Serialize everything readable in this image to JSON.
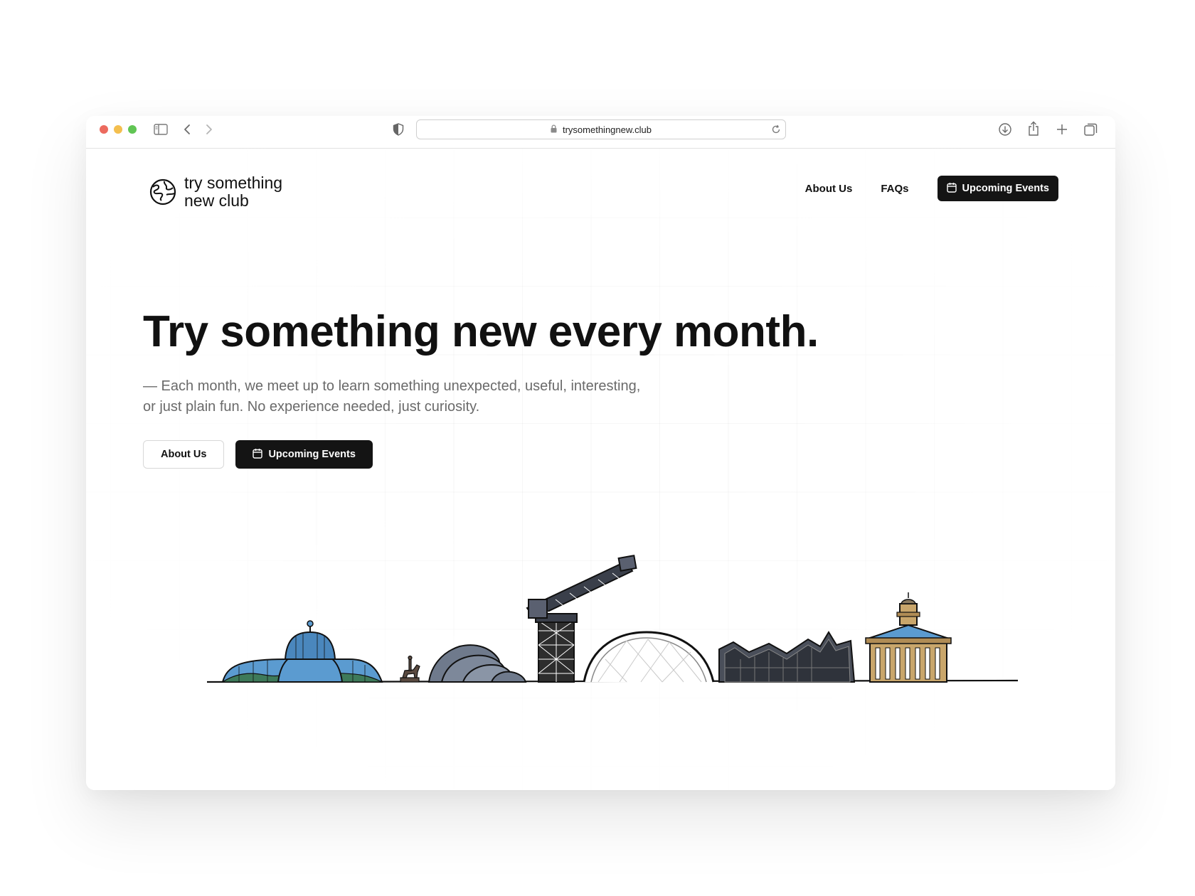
{
  "browser": {
    "url": "trysomethingnew.club",
    "traffic_light_colors": [
      "#ec6a5e",
      "#f4bf4f",
      "#61c554"
    ]
  },
  "header": {
    "logo_line1": "try something",
    "logo_line2": "new club",
    "nav": {
      "about": "About Us",
      "faqs": "FAQs",
      "events": "Upcoming Events"
    }
  },
  "hero": {
    "title": "Try something new every month.",
    "subtitle": "— Each month, we meet up to learn something unexpected, useful, interesting, or just plain fun. No experience needed, just curiosity.",
    "about_button": "About Us",
    "events_button": "Upcoming Events"
  },
  "colors": {
    "primary_button": "#141414",
    "heading": "#111111",
    "subtitle": "#6a6a6a",
    "glass_blue": "#5b9bd0",
    "hill_green": "#3e7a5a",
    "museum_tan": "#c9a66b",
    "steel_grey": "#6f7a8c"
  }
}
